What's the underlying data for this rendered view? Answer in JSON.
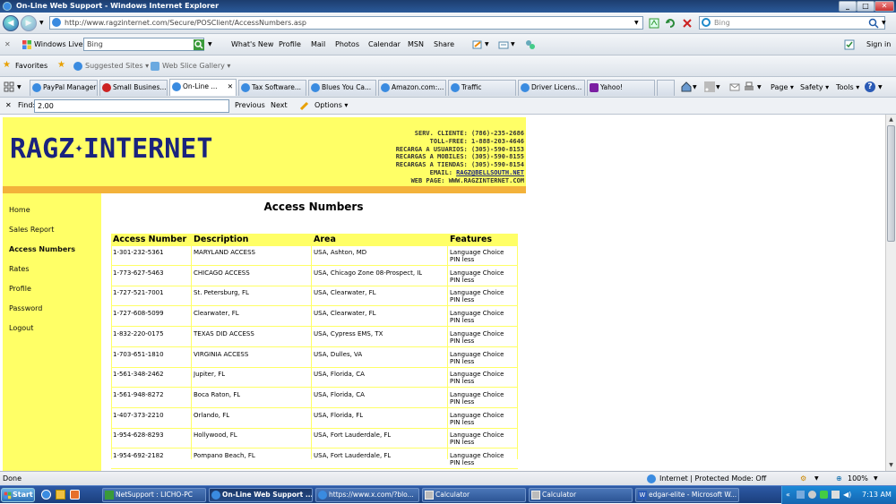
{
  "window": {
    "title": "On-Line Web Support - Windows Internet Explorer",
    "minimize": "_",
    "maximize": "□",
    "close": "✕"
  },
  "address": {
    "url": "http://www.ragzinternet.com/Secure/POSClient/AccessNumbers.asp",
    "search_placeholder": "Bing"
  },
  "livebar": {
    "windows_live": "Windows Live",
    "search_value": "Bing",
    "items": [
      "What's New",
      "Profile",
      "Mail",
      "Photos",
      "Calendar",
      "MSN",
      "Share"
    ],
    "signin": "Sign in"
  },
  "favbar": {
    "favorites": "Favorites",
    "suggested": "Suggested Sites ▾",
    "webslice": "Web Slice Gallery ▾"
  },
  "tabs": [
    {
      "label": "PayPal Manager",
      "active": false
    },
    {
      "label": "Small Busines...",
      "active": false
    },
    {
      "label": "On-Line ...",
      "active": true
    },
    {
      "label": "Tax Software...",
      "active": false
    },
    {
      "label": "Blues You Ca...",
      "active": false
    },
    {
      "label": "Amazon.com:...",
      "active": false
    },
    {
      "label": "Traffic",
      "active": false
    },
    {
      "label": "Driver Licens...",
      "active": false
    },
    {
      "label": "Yahoo!",
      "active": false
    }
  ],
  "commandbar": {
    "page": "Page ▾",
    "safety": "Safety ▾",
    "tools": "Tools ▾",
    "help": "?"
  },
  "findbar": {
    "label": "Find:",
    "value": "2.00",
    "previous": "Previous",
    "next": "Next",
    "options": "Options ▾"
  },
  "site": {
    "logo_left": "RAGZ",
    "logo_right": "INTERNET",
    "contact": [
      "SERV. CLIENTE: (786)-235-2686",
      "TOLL-FREE: 1-888-203-4646",
      "RECARGA A USUARIOS: (305)-590-8153",
      "RECARGAS A MOBILES: (305)-590-8155",
      "RECARGAS A TIENDAS: (305)-590-8154"
    ],
    "email_label": "EMAIL: ",
    "email": "RAGZ@BELLSOUTH.NET",
    "webpage": "WEB PAGE: WWW.RAGZINTERNET.COM"
  },
  "nav": [
    "Home",
    "Sales Report",
    "Access Numbers",
    "Rates",
    "Profile",
    "Password",
    "Logout"
  ],
  "page_title": "Access Numbers",
  "table": {
    "headers": [
      "Access Number",
      "Description",
      "Area",
      "Features"
    ],
    "rows": [
      {
        "number": "1-301-232-5361",
        "description": "MARYLAND ACCESS",
        "area": "USA, Ashton, MD",
        "f1": "Language Choice",
        "f2": "PIN less"
      },
      {
        "number": "1-773-627-5463",
        "description": "CHICAGO ACCESS",
        "area": "USA, Chicago Zone 08-Prospect, IL",
        "f1": "Language Choice",
        "f2": "PIN less"
      },
      {
        "number": "1-727-521-7001",
        "description": "St. Petersburg, FL",
        "area": "USA, Clearwater, FL",
        "f1": "Language Choice",
        "f2": "PIN less"
      },
      {
        "number": "1-727-608-5099",
        "description": "Clearwater, FL",
        "area": "USA, Clearwater, FL",
        "f1": "Language Choice",
        "f2": "PIN less"
      },
      {
        "number": "1-832-220-0175",
        "description": "TEXAS DID ACCESS",
        "area": "USA, Cypress EMS, TX",
        "f1": "Language Choice",
        "f2": "PIN less"
      },
      {
        "number": "1-703-651-1810",
        "description": "VIRGINIA ACCESS",
        "area": "USA, Dulles, VA",
        "f1": "Language Choice",
        "f2": "PIN less"
      },
      {
        "number": "1-561-348-2462",
        "description": "Jupiter, FL",
        "area": "USA, Florida, CA",
        "f1": "Language Choice",
        "f2": "PIN less"
      },
      {
        "number": "1-561-948-8272",
        "description": "Boca Raton, FL",
        "area": "USA, Florida, CA",
        "f1": "Language Choice",
        "f2": "PIN less"
      },
      {
        "number": "1-407-373-2210",
        "description": "Orlando, FL",
        "area": "USA, Florida, FL",
        "f1": "Language Choice",
        "f2": "PIN less"
      },
      {
        "number": "1-954-628-8293",
        "description": "Hollywood, FL",
        "area": "USA, Fort Lauderdale, FL",
        "f1": "Language Choice",
        "f2": "PIN less"
      },
      {
        "number": "1-954-692-2182",
        "description": "Pompano Beach, FL",
        "area": "USA, Fort Lauderdale, FL",
        "f1": "Language Choice",
        "f2": "PIN less"
      }
    ]
  },
  "status": {
    "left": "Done",
    "zone": "Internet | Protected Mode: Off",
    "zoom": "100%"
  },
  "taskbar": {
    "start": "Start",
    "tasks": [
      {
        "label": "NetSupport : LICHO-PC",
        "active": false
      },
      {
        "label": "On-Line Web Support ...",
        "active": true
      },
      {
        "label": "https://www.x.com/?blo...",
        "active": false
      },
      {
        "label": "Calculator",
        "active": false
      },
      {
        "label": "Calculator",
        "active": false
      },
      {
        "label": "edgar-elite - Microsoft W...",
        "active": false
      }
    ],
    "time": "7:13 AM"
  },
  "colors": {
    "site_yellow": "#ffff66",
    "site_orange": "#f3b23a",
    "logo_navy": "#1a237e"
  }
}
